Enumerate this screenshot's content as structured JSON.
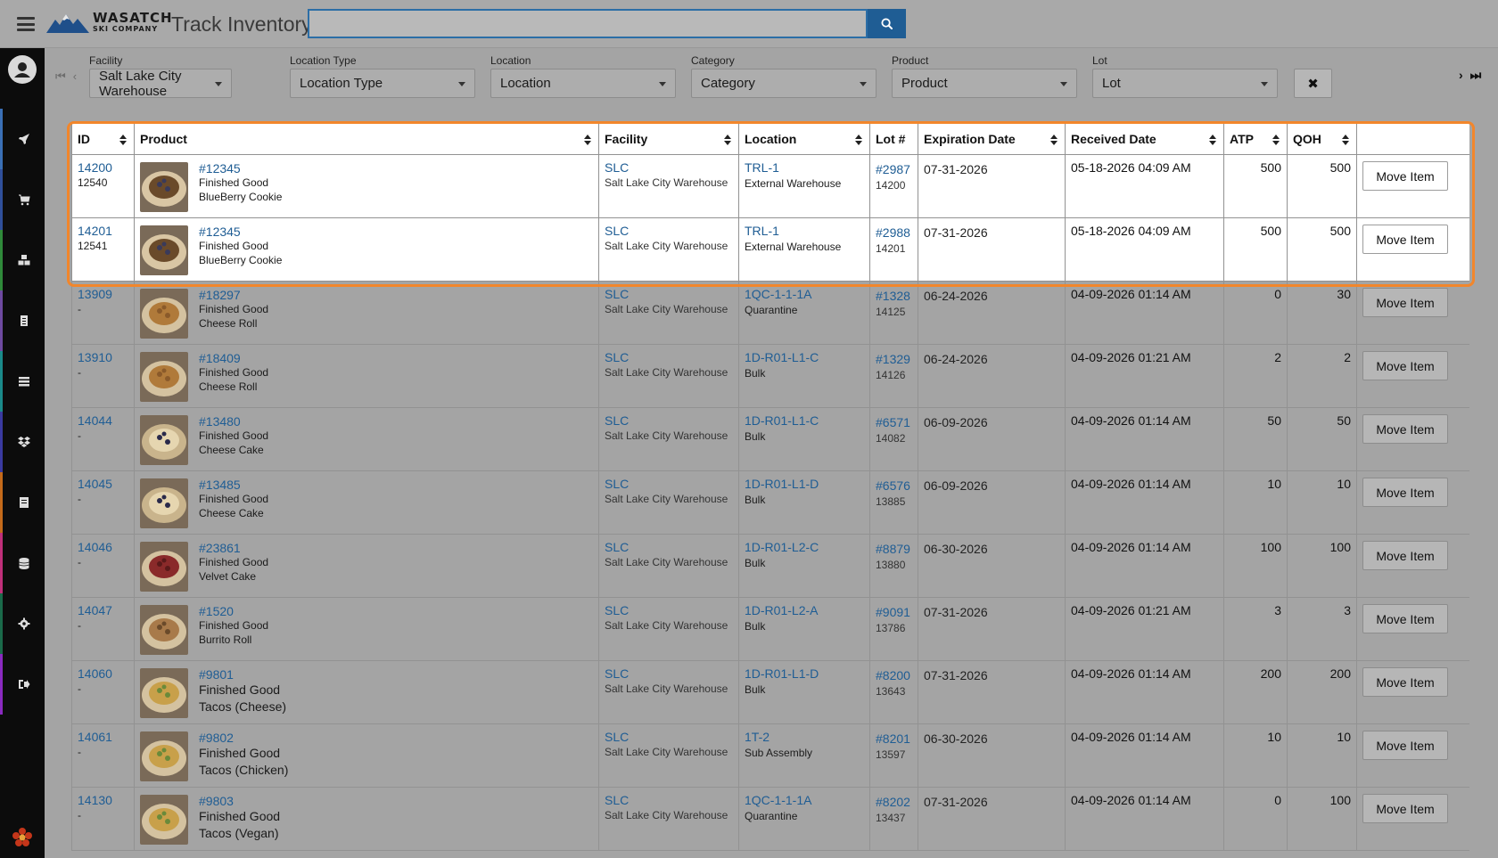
{
  "header": {
    "logo_line1": "WASATCH",
    "logo_line2": "SKI COMPANY",
    "title": "Track Inventory",
    "search_value": "",
    "search_placeholder": ""
  },
  "filters": [
    {
      "label": "Facility",
      "value": "Salt Lake City Warehouse"
    },
    {
      "label": "Location Type",
      "value": "Location Type"
    },
    {
      "label": "Location",
      "value": "Location"
    },
    {
      "label": "Category",
      "value": "Category"
    },
    {
      "label": "Product",
      "value": "Product"
    },
    {
      "label": "Lot",
      "value": "Lot"
    }
  ],
  "clear_label": "✖",
  "columns": [
    "ID",
    "Product",
    "Facility",
    "Location",
    "Lot #",
    "Expiration Date",
    "Received Date",
    "ATP",
    "QOH",
    ""
  ],
  "move_label": "Move Item",
  "rows": [
    {
      "id": "14200",
      "sub_id": "12540",
      "sku": "#12345",
      "category": "Finished Good",
      "name": "BlueBerry Cookie",
      "fac": "SLC",
      "fac_name": "Salt Lake City Warehouse",
      "loc": "TRL-1",
      "loc_name": "External Warehouse",
      "lot": "#2987",
      "lot_sub": "14200",
      "exp": "07-31-2026",
      "recv": "05-18-2026 04:09 AM",
      "atp": "500",
      "qoh": "500"
    },
    {
      "id": "14201",
      "sub_id": "12541",
      "sku": "#12345",
      "category": "Finished Good",
      "name": "BlueBerry Cookie",
      "fac": "SLC",
      "fac_name": "Salt Lake City Warehouse",
      "loc": "TRL-1",
      "loc_name": "External Warehouse",
      "lot": "#2988",
      "lot_sub": "14201",
      "exp": "07-31-2026",
      "recv": "05-18-2026 04:09 AM",
      "atp": "500",
      "qoh": "500"
    },
    {
      "id": "13909",
      "sub_id": "-",
      "sku": "#18297",
      "category": "Finished Good",
      "name": "Cheese Roll",
      "fac": "SLC",
      "fac_name": "Salt Lake City Warehouse",
      "loc": "1QC-1-1-1A",
      "loc_name": "Quarantine",
      "lot": "#1328",
      "lot_sub": "14125",
      "exp": "06-24-2026",
      "recv": "04-09-2026 01:14 AM",
      "atp": "0",
      "qoh": "30"
    },
    {
      "id": "13910",
      "sub_id": "-",
      "sku": "#18409",
      "category": "Finished Good",
      "name": "Cheese Roll",
      "fac": "SLC",
      "fac_name": "Salt Lake City Warehouse",
      "loc": "1D-R01-L1-C",
      "loc_name": "Bulk",
      "lot": "#1329",
      "lot_sub": "14126",
      "exp": "06-24-2026",
      "recv": "04-09-2026 01:21 AM",
      "atp": "2",
      "qoh": "2"
    },
    {
      "id": "14044",
      "sub_id": "-",
      "sku": "#13480",
      "category": "Finished Good",
      "name": "Cheese Cake",
      "fac": "SLC",
      "fac_name": "Salt Lake City Warehouse",
      "loc": "1D-R01-L1-C",
      "loc_name": "Bulk",
      "lot": "#6571",
      "lot_sub": "14082",
      "exp": "06-09-2026",
      "recv": "04-09-2026 01:14 AM",
      "atp": "50",
      "qoh": "50"
    },
    {
      "id": "14045",
      "sub_id": "-",
      "sku": "#13485",
      "category": "Finished Good",
      "name": "Cheese Cake",
      "fac": "SLC",
      "fac_name": "Salt Lake City Warehouse",
      "loc": "1D-R01-L1-D",
      "loc_name": "Bulk",
      "lot": "#6576",
      "lot_sub": "13885",
      "exp": "06-09-2026",
      "recv": "04-09-2026 01:14 AM",
      "atp": "10",
      "qoh": "10"
    },
    {
      "id": "14046",
      "sub_id": "-",
      "sku": "#23861",
      "category": "Finished Good",
      "name": "Velvet Cake",
      "fac": "SLC",
      "fac_name": "Salt Lake City Warehouse",
      "loc": "1D-R01-L2-C",
      "loc_name": "Bulk",
      "lot": "#8879",
      "lot_sub": "13880",
      "exp": "06-30-2026",
      "recv": "04-09-2026 01:14 AM",
      "atp": "100",
      "qoh": "100"
    },
    {
      "id": "14047",
      "sub_id": "-",
      "sku": "#1520",
      "category": "Finished Good",
      "name": "Burrito Roll",
      "fac": "SLC",
      "fac_name": "Salt Lake City Warehouse",
      "loc": "1D-R01-L2-A",
      "loc_name": "Bulk",
      "lot": "#9091",
      "lot_sub": "13786",
      "exp": "07-31-2026",
      "recv": "04-09-2026 01:21 AM",
      "atp": "3",
      "qoh": "3"
    },
    {
      "id": "14060",
      "sub_id": "-",
      "sku": "#9801",
      "category": "Finished Good",
      "name": "Tacos (Cheese)",
      "fac": "SLC",
      "fac_name": "Salt Lake City Warehouse",
      "loc": "1D-R01-L1-D",
      "loc_name": "Bulk",
      "lot": "#8200",
      "lot_sub": "13643",
      "exp": "07-31-2026",
      "recv": "04-09-2026 01:14 AM",
      "atp": "200",
      "qoh": "200"
    },
    {
      "id": "14061",
      "sub_id": "-",
      "sku": "#9802",
      "category": "Finished Good",
      "name": "Tacos (Chicken)",
      "fac": "SLC",
      "fac_name": "Salt Lake City Warehouse",
      "loc": "1T-2",
      "loc_name": "Sub Assembly",
      "lot": "#8201",
      "lot_sub": "13597",
      "exp": "06-30-2026",
      "recv": "04-09-2026 01:14 AM",
      "atp": "10",
      "qoh": "10"
    },
    {
      "id": "14130",
      "sub_id": "-",
      "sku": "#9803",
      "category": "Finished Good",
      "name": "Tacos (Vegan)",
      "fac": "SLC",
      "fac_name": "Salt Lake City Warehouse",
      "loc": "1QC-1-1-1A",
      "loc_name": "Quarantine",
      "lot": "#8202",
      "lot_sub": "13437",
      "exp": "07-31-2026",
      "recv": "04-09-2026 01:14 AM",
      "atp": "0",
      "qoh": "100"
    }
  ],
  "sidebar": {
    "items": [
      {
        "icon": "rocket-icon",
        "accent": "#3a6fb5"
      },
      {
        "icon": "cart-icon",
        "accent": "#2f4f9a"
      },
      {
        "icon": "cubes-icon",
        "accent": "#2f8a3a"
      },
      {
        "icon": "clipboard-icon",
        "accent": "#6e4aa0"
      },
      {
        "icon": "list-icon",
        "accent": "#1a8a8a"
      },
      {
        "icon": "dropbox-icon",
        "accent": "#3a3aa0"
      },
      {
        "icon": "receipt-icon",
        "accent": "#c46a1a"
      },
      {
        "icon": "database-icon",
        "accent": "#c0307a"
      },
      {
        "icon": "gear-icon",
        "accent": "#1a6a4a"
      },
      {
        "icon": "signout-icon",
        "accent": "#8a2ac0"
      }
    ]
  },
  "colors": {
    "link": "#1f5d94",
    "highlight": "#f2862b",
    "search_btn": "#1f5d94"
  }
}
